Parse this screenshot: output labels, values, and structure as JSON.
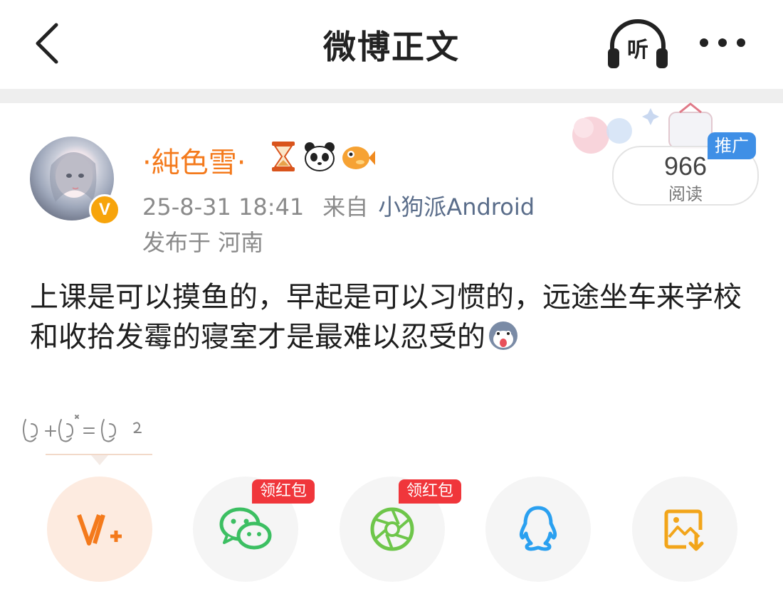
{
  "header": {
    "title": "微博正文",
    "listen_label": "听"
  },
  "post": {
    "author": "·純色雪·",
    "avatar_badge": "V",
    "timestamp": "25-8-31 18:41",
    "from_label": "来自",
    "source": "小狗派Android",
    "location": "发布于 河南",
    "text": "上课是可以摸鱼的，早起是可以习惯的，远途坐车来学校和收拾发霉的寝室才是最难以忍受的",
    "reads": {
      "count": "966",
      "label": "阅读"
    },
    "promo_badge": "推广"
  },
  "share": {
    "redpacket_label_1": "领红包",
    "redpacket_label_2": "领红包",
    "items": [
      "vplus-share",
      "wechat-share",
      "moments-share",
      "qq-share",
      "save-image-share"
    ]
  },
  "colors": {
    "accent": "#f47a1c",
    "source_link": "#5a6d8a",
    "redpacket": "#f0363b",
    "promo": "#3f8fe6"
  }
}
